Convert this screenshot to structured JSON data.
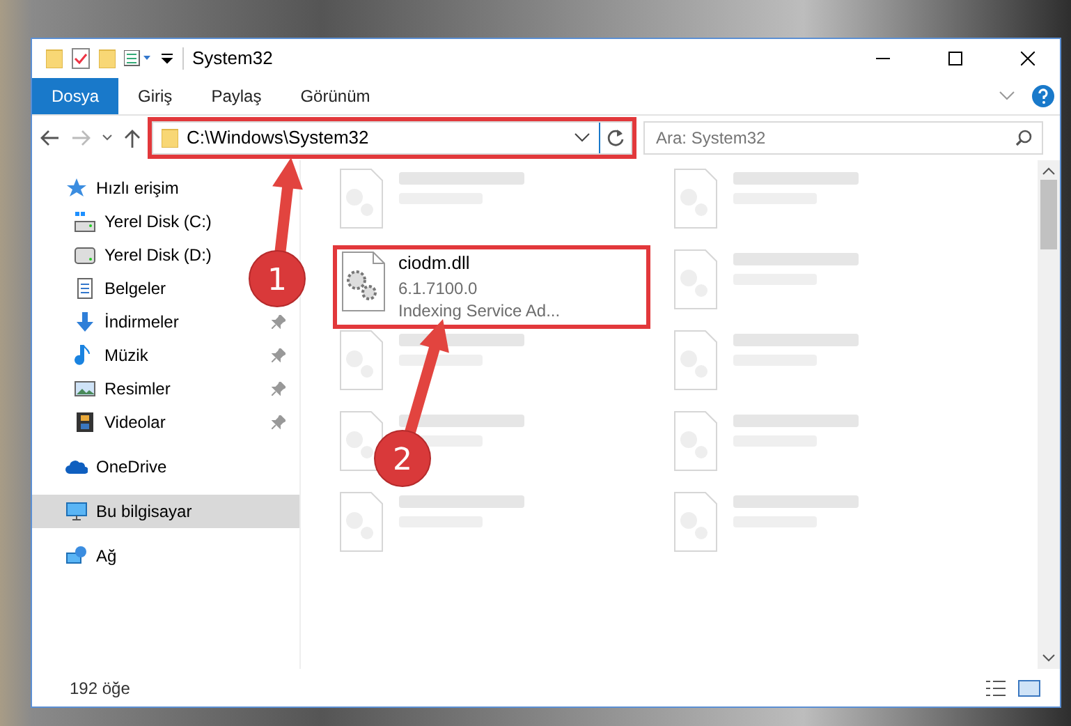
{
  "window": {
    "title": "System32"
  },
  "ribbon_tabs": [
    {
      "label": "Dosya",
      "selected": true
    },
    {
      "label": "Giriş",
      "selected": false
    },
    {
      "label": "Paylaş",
      "selected": false
    },
    {
      "label": "Görünüm",
      "selected": false
    }
  ],
  "address": {
    "path": "C:\\Windows\\System32",
    "highlighted": true
  },
  "search": {
    "placeholder": "Ara: System32"
  },
  "sidebar": {
    "items": [
      {
        "label": "Hızlı erişim",
        "kind": "star",
        "pinned": false,
        "selected": false,
        "children": [
          {
            "label": "Yerel Disk (C:)",
            "kind": "sysdrive",
            "pinned": false,
            "selected": false
          },
          {
            "label": "Yerel Disk (D:)",
            "kind": "drive",
            "pinned": false,
            "selected": false
          },
          {
            "label": "Belgeler",
            "kind": "doc",
            "pinned": false,
            "selected": false
          },
          {
            "label": "İndirmeler",
            "kind": "download",
            "pinned": true,
            "selected": false
          },
          {
            "label": "Müzik",
            "kind": "music",
            "pinned": true,
            "selected": false
          },
          {
            "label": "Resimler",
            "kind": "pictures",
            "pinned": true,
            "selected": false
          },
          {
            "label": "Videolar",
            "kind": "video",
            "pinned": true,
            "selected": false
          }
        ]
      },
      {
        "label": "OneDrive",
        "kind": "cloud",
        "pinned": false,
        "selected": false
      },
      {
        "label": "Bu bilgisayar",
        "kind": "pc",
        "pinned": false,
        "selected": true
      },
      {
        "label": "Ağ",
        "kind": "network",
        "pinned": false,
        "selected": false
      }
    ]
  },
  "files": [
    {
      "kind": "blurred"
    },
    {
      "kind": "blurred"
    },
    {
      "kind": "file",
      "name": "ciodm.dll",
      "lines": [
        "6.1.7100.0",
        "Indexing Service Ad..."
      ],
      "highlighted": true
    },
    {
      "kind": "blurred"
    },
    {
      "kind": "blurred"
    },
    {
      "kind": "blurred"
    },
    {
      "kind": "blurred"
    },
    {
      "kind": "blurred"
    },
    {
      "kind": "blurred"
    },
    {
      "kind": "blurred"
    }
  ],
  "status_bar": {
    "count": "192 öğe"
  },
  "annotations": [
    {
      "number": "1"
    },
    {
      "number": "2"
    }
  ]
}
